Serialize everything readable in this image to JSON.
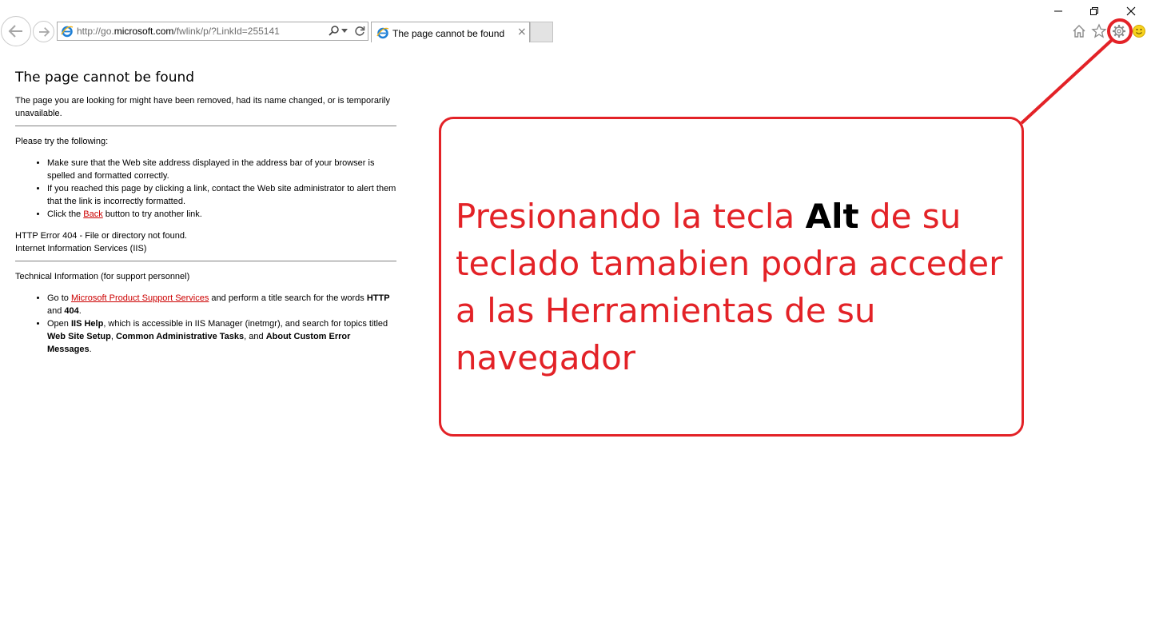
{
  "browser": {
    "url_prefix": "http://go.",
    "url_domain": "microsoft.com",
    "url_path": "/fwlink/p/?LinkId=255141",
    "tab_title": "The page cannot be found",
    "tab_close": "×"
  },
  "error_page": {
    "title": "The page cannot be found",
    "intro": "The page you are looking for might have been removed, had its name changed, or is temporarily unavailable.",
    "try_heading": "Please try the following:",
    "try_items": [
      "Make sure that the Web site address displayed in the address bar of your browser is spelled and formatted correctly.",
      "If you reached this page by clicking a link, contact the Web site administrator to alert them that the link is incorrectly formatted."
    ],
    "try_click_prefix": "Click the ",
    "back_link": "Back",
    "try_click_suffix": " button to try another link.",
    "http_error": "HTTP Error 404 - File or directory not found.",
    "server": "Internet Information Services (IIS)",
    "tech_heading": "Technical Information (for support personnel)",
    "goto_prefix": "Go to ",
    "support_link": "Microsoft Product Support Services",
    "goto_mid": " and perform a title search for the words ",
    "word_http": "HTTP",
    "word_and": " and ",
    "word_404": "404",
    "period": ".",
    "open_prefix": "Open ",
    "iis_help": "IIS Help",
    "open_mid": ", which is accessible in IIS Manager (inetmgr), and search for topics titled ",
    "topic1": "Web Site Setup",
    "comma": ", ",
    "topic2": "Common Administrative Tasks",
    "and_text": ", and ",
    "topic3": "About Custom Error Messages"
  },
  "annotation": {
    "text_before": "Presionando la tecla ",
    "key": "Alt",
    "text_after": " de su teclado tamabien podra acceder a las Herramientas de su navegador",
    "color": "#e32227"
  }
}
